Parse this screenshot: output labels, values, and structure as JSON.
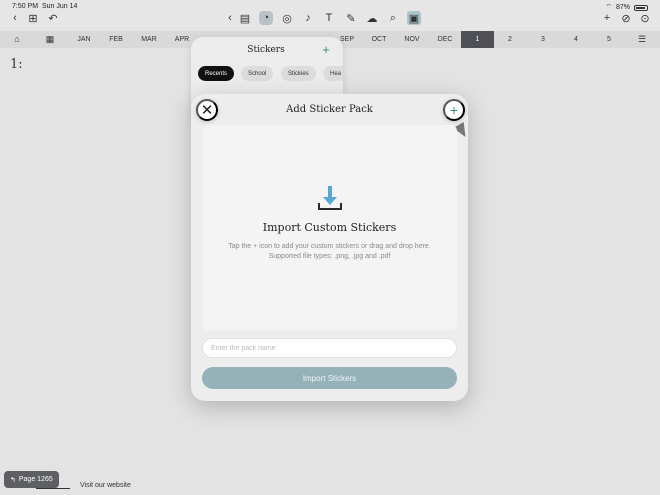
{
  "status": {
    "time": "7:50 PM",
    "date": "Sun Jun 14",
    "battery": "87%"
  },
  "toolbar": {
    "left_icons": [
      "back-icon",
      "grid-icon",
      "undo-icon"
    ],
    "center_icons": [
      "sticky-note-icon",
      "sticker-icon",
      "lasso-icon",
      "microphone-icon",
      "text-icon",
      "pen-icon",
      "shape-icon",
      "search-icon",
      "image-icon"
    ],
    "right_icons": [
      "add-icon",
      "hide-icon",
      "more-icon"
    ]
  },
  "tabs": {
    "months": [
      "JAN",
      "FEB",
      "MAR",
      "APR",
      "SEP",
      "OCT",
      "NOV",
      "DEC"
    ],
    "numbers": [
      "1",
      "2",
      "3",
      "4",
      "5"
    ],
    "active": "1"
  },
  "page": {
    "number_label": "1:",
    "page_badge": "Page 1265",
    "website_link": "Visit our website"
  },
  "stickers_panel": {
    "title": "Stickers",
    "add_label": "+",
    "chips": [
      "Recents",
      "School",
      "Stickies",
      "Hea"
    ]
  },
  "modal": {
    "title": "Add Sticker Pack",
    "close_label": "✕",
    "add_label": "+",
    "import_title": "Import Custom Stickers",
    "import_description": "Tap the + icon to add your custom stickers or drag and drop here. Supported file types: .png, .jpg and .pdf",
    "pack_name_placeholder": "Enter the pack name",
    "pack_name_value": "",
    "import_button": "Import Stickers"
  },
  "colors": {
    "accent": "#3c8c7d",
    "button": "#96b2b9",
    "active_tab": "#4e5055"
  }
}
